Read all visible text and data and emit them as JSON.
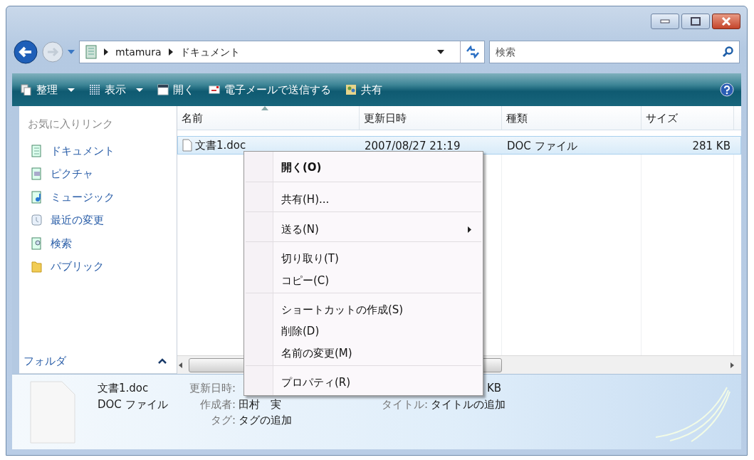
{
  "address_bar": {
    "breadcrumbs": [
      "mtamura",
      "ドキュメント"
    ]
  },
  "search": {
    "placeholder": "検索"
  },
  "toolbar": {
    "items": [
      {
        "label": "整理",
        "dropdown": true
      },
      {
        "label": "表示",
        "dropdown": true
      },
      {
        "label": "開く",
        "dropdown": false
      },
      {
        "label": "電子メールで送信する",
        "dropdown": false
      },
      {
        "label": "共有",
        "dropdown": false
      }
    ]
  },
  "sidebar": {
    "title": "お気に入りリンク",
    "items": [
      {
        "label": "ドキュメント"
      },
      {
        "label": "ピクチャ"
      },
      {
        "label": "ミュージック"
      },
      {
        "label": "最近の変更"
      },
      {
        "label": "検索"
      },
      {
        "label": "パブリック"
      }
    ],
    "folders_label": "フォルダ"
  },
  "file_list": {
    "columns": [
      {
        "label": "名前",
        "sorted": true
      },
      {
        "label": "更新日時",
        "sorted": false
      },
      {
        "label": "種類",
        "sorted": false
      },
      {
        "label": "サイズ",
        "sorted": false
      }
    ],
    "rows": [
      {
        "name": "文書1.doc",
        "modified": "2007/08/27 21:19",
        "type": "DOC ファイル",
        "size": "281 KB",
        "selected": true
      }
    ]
  },
  "context_menu": {
    "items": [
      {
        "label": "開く(O)",
        "default": true,
        "submenu": false,
        "separator_after": true
      },
      {
        "label": "共有(H)...",
        "default": false,
        "submenu": false,
        "separator_after": true
      },
      {
        "label": "送る(N)",
        "default": false,
        "submenu": true,
        "separator_after": true
      },
      {
        "label": "切り取り(T)",
        "default": false,
        "submenu": false,
        "separator_after": false
      },
      {
        "label": "コピー(C)",
        "default": false,
        "submenu": false,
        "separator_after": true
      },
      {
        "label": "ショートカットの作成(S)",
        "default": false,
        "submenu": false,
        "separator_after": false
      },
      {
        "label": "削除(D)",
        "default": false,
        "submenu": false,
        "separator_after": false
      },
      {
        "label": "名前の変更(M)",
        "default": false,
        "submenu": false,
        "separator_after": true
      },
      {
        "label": "プロパティ(R)",
        "default": false,
        "submenu": false,
        "separator_after": false
      }
    ]
  },
  "details": {
    "name": "文書1.doc",
    "type": "DOC ファイル",
    "fields": [
      {
        "label": "更新日時:"
      },
      {
        "label": "作成者:",
        "value": "田村　実"
      },
      {
        "label": "タグ:",
        "value": "タグの追加"
      }
    ],
    "size_fragment": "KB",
    "title_field": {
      "label": "タイトル:",
      "value": "タイトルの追加"
    }
  }
}
